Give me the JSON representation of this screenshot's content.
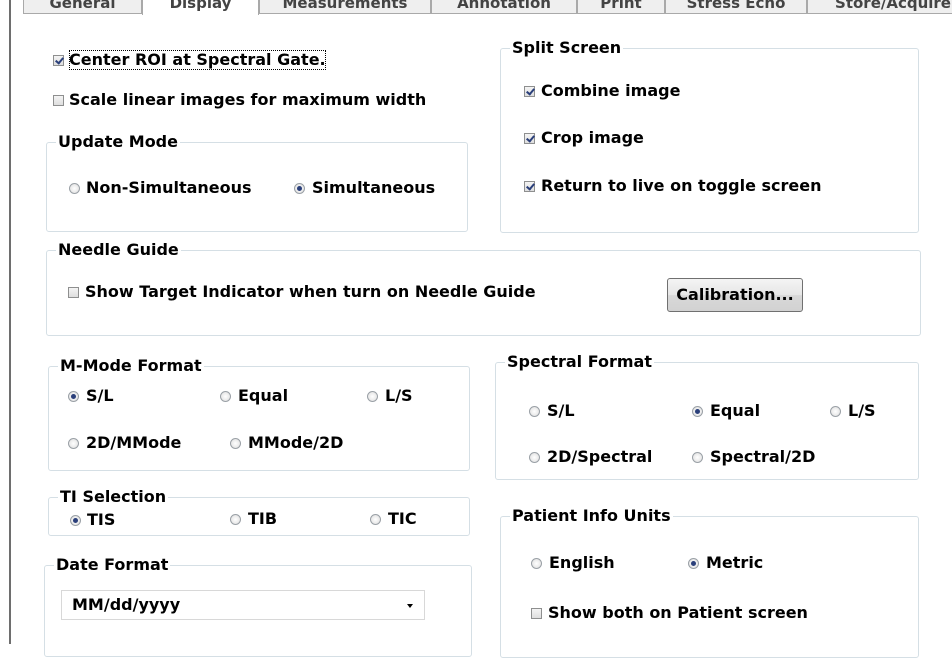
{
  "tabs": [
    "General",
    "Display",
    "Measurements",
    "Annotation",
    "Print",
    "Stress Echo",
    "Store/Acquire"
  ],
  "center_roi": {
    "label": "Center ROI at Spectral Gate.",
    "checked": true
  },
  "scale_linear": {
    "label": "Scale linear images for maximum width",
    "checked": false
  },
  "update_mode": {
    "title": "Update Mode",
    "options": [
      "Non-Simultaneous",
      "Simultaneous"
    ],
    "selected": "Simultaneous"
  },
  "split_screen": {
    "title": "Split Screen",
    "items": [
      {
        "label": "Combine image",
        "checked": true
      },
      {
        "label": "Crop image",
        "checked": true
      },
      {
        "label": "Return to live on toggle screen",
        "checked": true
      }
    ]
  },
  "needle_guide": {
    "title": "Needle Guide",
    "show_target": {
      "label": "Show Target Indicator when turn on Needle Guide",
      "checked": false
    },
    "calibration_label": "Calibration..."
  },
  "mmode_format": {
    "title": "M-Mode Format",
    "options": [
      "S/L",
      "Equal",
      "L/S",
      "2D/MMode",
      "MMode/2D"
    ],
    "selected": "S/L"
  },
  "spectral_format": {
    "title": "Spectral Format",
    "options": [
      "S/L",
      "Equal",
      "L/S",
      "2D/Spectral",
      "Spectral/2D"
    ],
    "selected": "Equal"
  },
  "ti_selection": {
    "title": "TI Selection",
    "options": [
      "TIS",
      "TIB",
      "TIC"
    ],
    "selected": "TIS"
  },
  "patient_units": {
    "title": "Patient Info Units",
    "options": [
      "English",
      "Metric"
    ],
    "selected": "Metric",
    "show_both": {
      "label": "Show both on Patient screen",
      "checked": false
    }
  },
  "date_format": {
    "title": "Date Format",
    "value": "MM/dd/yyyy"
  }
}
